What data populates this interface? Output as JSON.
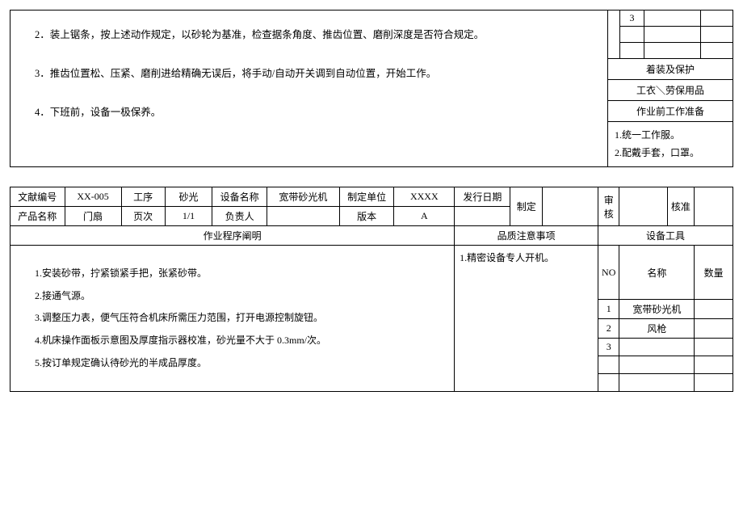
{
  "top": {
    "steps": [
      "2．装上锯条，按上述动作规定，以砂轮为基准，检查据条角度、推齿位置、磨削深度是否符合规定。",
      "3．推齿位置松、压紧、磨削进给精确无误后，将手动/自动开关调到自动位置，开始工作。",
      "4．下班前，设备一极保养。"
    ],
    "equip_num": "3",
    "section1": "着装及保护",
    "section1_body": "工衣＼劳保用品",
    "section2": "作业前工作准备",
    "prep1": "1.统一工作服。",
    "prep2": "2.配戴手套，口罩。"
  },
  "form": {
    "labels": {
      "doc_no": "文献编号",
      "process": "工序",
      "equip_name": "设备名称",
      "dept": "制定单位",
      "issue_date": "发行日期",
      "product": "产品名称",
      "page": "页次",
      "owner": "负责人",
      "version": "版本",
      "draft": "制定",
      "review": "审核",
      "approve": "核准",
      "proc_desc": "作业程序阐明",
      "quality": "品质注意事项",
      "tools": "设备工具",
      "no": "NO",
      "name": "名称",
      "qty": "数量"
    },
    "values": {
      "doc_no": "XX-005",
      "process": "砂光",
      "equip_name": "宽带砂光机",
      "dept": "XXXX",
      "issue_date": "",
      "product": "门扇",
      "page": "1/1",
      "owner": "",
      "version": "A"
    },
    "quality_note": "1.精密设备专人开机。",
    "steps": [
      "1.安装砂带，拧紧锁紧手把，张紧砂带。",
      "2.接通气源。",
      "3.调整压力表，便气压符合机床所需压力范围，打开电源控制旋钮。",
      "4.机床操作面板示意图及厚度指示器校准，砂光量不大于 0.3mm/次。",
      "5.按订单规定确认待砂光的半成品厚度。"
    ],
    "equipment": [
      {
        "no": "1",
        "name": "宽带砂光机",
        "qty": ""
      },
      {
        "no": "2",
        "name": "风枪",
        "qty": ""
      },
      {
        "no": "3",
        "name": "",
        "qty": ""
      },
      {
        "no": "",
        "name": "",
        "qty": ""
      },
      {
        "no": "",
        "name": "",
        "qty": ""
      }
    ]
  }
}
